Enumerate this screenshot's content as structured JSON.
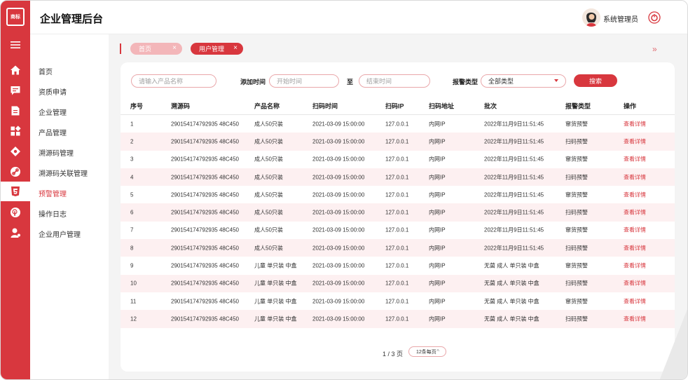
{
  "app": {
    "title": "企业管理后台",
    "logo_text": "商标"
  },
  "user": {
    "name": "系统管理员"
  },
  "rail_icons": [
    "menu-icon",
    "home-icon",
    "chat-icon",
    "document-icon",
    "grid-icon",
    "tag-icon",
    "link-icon",
    "html5-icon",
    "touch-icon",
    "user-icon"
  ],
  "sidebar": {
    "items": [
      {
        "label": "首页"
      },
      {
        "label": "资质申请"
      },
      {
        "label": "企业管理"
      },
      {
        "label": "产品管理"
      },
      {
        "label": "溯源码管理"
      },
      {
        "label": "溯源码关联管理"
      },
      {
        "label": "预警管理"
      },
      {
        "label": "操作日志"
      },
      {
        "label": "企业用户管理"
      }
    ],
    "active_index": 6
  },
  "tabs": [
    {
      "label": "首页",
      "close": "×"
    },
    {
      "label": "用户管理",
      "close": "×"
    }
  ],
  "tabs_more": "»",
  "filters": {
    "product_placeholder": "请输入产品名称",
    "add_time_label": "添加时间",
    "start_placeholder": "开始时间",
    "to_label": "至",
    "end_placeholder": "结束时间",
    "alert_type_label": "报警类型",
    "alert_type_value": "全部类型",
    "search_label": "搜索"
  },
  "table": {
    "headers": [
      "序号",
      "溯源码",
      "产品名称",
      "扫码时间",
      "扫码IP",
      "扫码地址",
      "批次",
      "报警类型",
      "操作"
    ],
    "rows": [
      [
        "1",
        "290154174792935 48C450",
        "成人50只装",
        "2021-03-09 15:00:00",
        "127.0.0.1",
        "内网IP",
        "2022年11月9日11:51:45",
        "窜货预警",
        "查看详情"
      ],
      [
        "2",
        "290154174792935 48C450",
        "成人50只装",
        "2021-03-09 15:00:00",
        "127.0.0.1",
        "内网IP",
        "2022年11月9日11:51:45",
        "扫码预警",
        "查看详情"
      ],
      [
        "3",
        "290154174792935 48C450",
        "成人50只装",
        "2021-03-09 15:00:00",
        "127.0.0.1",
        "内网IP",
        "2022年11月9日11:51:45",
        "窜货预警",
        "查看详情"
      ],
      [
        "4",
        "290154174792935 48C450",
        "成人50只装",
        "2021-03-09 15:00:00",
        "127.0.0.1",
        "内网IP",
        "2022年11月9日11:51:45",
        "扫码预警",
        "查看详情"
      ],
      [
        "5",
        "290154174792935 48C450",
        "成人50只装",
        "2021-03-09 15:00:00",
        "127.0.0.1",
        "内网IP",
        "2022年11月9日11:51:45",
        "窜货预警",
        "查看详情"
      ],
      [
        "6",
        "290154174792935 48C450",
        "成人50只装",
        "2021-03-09 15:00:00",
        "127.0.0.1",
        "内网IP",
        "2022年11月9日11:51:45",
        "扫码预警",
        "查看详情"
      ],
      [
        "7",
        "290154174792935 48C450",
        "成人50只装",
        "2021-03-09 15:00:00",
        "127.0.0.1",
        "内网IP",
        "2022年11月9日11:51:45",
        "窜货预警",
        "查看详情"
      ],
      [
        "8",
        "290154174792935 48C450",
        "成人50只装",
        "2021-03-09 15:00:00",
        "127.0.0.1",
        "内网IP",
        "2022年11月9日11:51:45",
        "扫码预警",
        "查看详情"
      ],
      [
        "9",
        "290154174792935 48C450",
        "儿童 单只装 中盒",
        "2021-03-09 15:00:00",
        "127.0.0.1",
        "内网IP",
        "无菌 成人 单只装 中盒",
        "窜货预警",
        "查看详情"
      ],
      [
        "10",
        "290154174792935 48C450",
        "儿童 单只装 中盒",
        "2021-03-09 15:00:00",
        "127.0.0.1",
        "内网IP",
        "无菌 成人 单只装 中盒",
        "扫码预警",
        "查看详情"
      ],
      [
        "11",
        "290154174792935 48C450",
        "儿童 单只装 中盒",
        "2021-03-09 15:00:00",
        "127.0.0.1",
        "内网IP",
        "无菌 成人 单只装 中盒",
        "窜货预警",
        "查看详情"
      ],
      [
        "12",
        "290154174792935 48C450",
        "儿童 单只装 中盒",
        "2021-03-09 15:00:00",
        "127.0.0.1",
        "内网IP",
        "无菌 成人 单只装 中盒",
        "扫码预警",
        "查看详情"
      ]
    ]
  },
  "pager": {
    "text": "1 / 3 页",
    "page_size": "12条每页",
    "toggle": "^"
  },
  "colors": {
    "accent": "#d8373e",
    "accent_light": "#f3b6b9",
    "row_alt": "#fdf0f1",
    "bg": "#f4f4f4"
  }
}
